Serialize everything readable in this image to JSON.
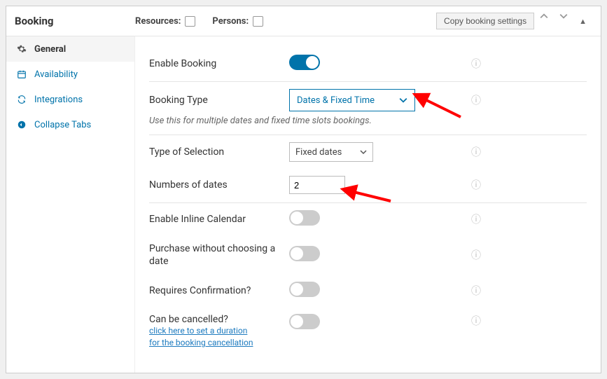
{
  "topbar": {
    "title": "Booking",
    "resources_label": "Resources:",
    "persons_label": "Persons:",
    "copy_button": "Copy booking settings"
  },
  "sidebar": {
    "items": [
      {
        "label": "General"
      },
      {
        "label": "Availability"
      },
      {
        "label": "Integrations"
      },
      {
        "label": "Collapse Tabs"
      }
    ]
  },
  "main": {
    "enable_booking": "Enable Booking",
    "booking_type": "Booking Type",
    "booking_type_value": "Dates & Fixed Time",
    "booking_type_hint": "Use this for multiple dates and fixed time slots bookings.",
    "type_of_selection": "Type of Selection",
    "type_of_selection_value": "Fixed dates",
    "numbers_of_dates": "Numbers of dates",
    "numbers_of_dates_value": "2",
    "enable_inline_calendar": "Enable Inline Calendar",
    "purchase_without_date": "Purchase without choosing a date",
    "requires_confirmation": "Requires Confirmation?",
    "can_be_cancelled": "Can be cancelled?",
    "cancel_link1": "click here to set a duration",
    "cancel_link2": "for the booking cancellation"
  }
}
